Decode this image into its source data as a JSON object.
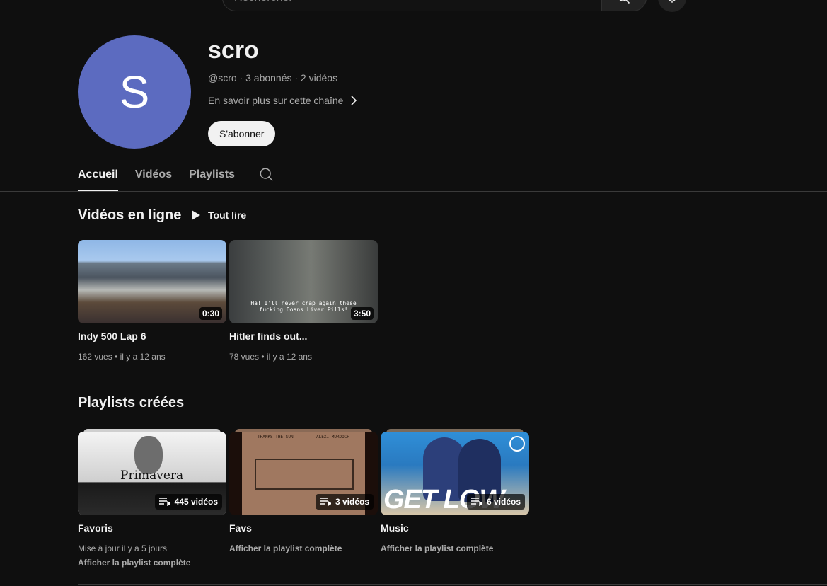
{
  "search": {
    "placeholder": "Rechercher"
  },
  "channel": {
    "avatar_letter": "S",
    "avatar_color": "#5c6bc0",
    "name": "scro",
    "meta": "@scro · 3 abonnés · 2 vidéos",
    "about": "En savoir plus sur cette chaîne",
    "subscribe_label": "S'abonner"
  },
  "tabs": [
    {
      "label": "Accueil",
      "active": true
    },
    {
      "label": "Vidéos",
      "active": false
    },
    {
      "label": "Playlists",
      "active": false
    }
  ],
  "uploads": {
    "title": "Vidéos en ligne",
    "play_all": "Tout lire",
    "videos": [
      {
        "title": "Indy 500 Lap 6",
        "duration": "0:30",
        "views": "162 vues",
        "age": "il y a 12 ans"
      },
      {
        "title": "Hitler finds out...",
        "duration": "3:50",
        "views": "78 vues",
        "age": "il y a 12 ans",
        "subtitle": "Ha! I'll never crap again these fucking Doans Liver Pills!"
      }
    ]
  },
  "playlists": {
    "title": "Playlists créées",
    "items": [
      {
        "title": "Favoris",
        "count": "445 vidéos",
        "updated": "Mise à jour il y a 5 jours",
        "link": "Afficher la playlist complète",
        "thumb_text": "Primavera"
      },
      {
        "title": "Favs",
        "count": "3 vidéos",
        "link": "Afficher la playlist complète",
        "thumb_left": "THANKS THE SUN",
        "thumb_right": "ALEXI MURDOCH"
      },
      {
        "title": "Music",
        "count": "6 vidéos",
        "link": "Afficher la playlist complète",
        "thumb_text": "GET LOW"
      }
    ]
  }
}
